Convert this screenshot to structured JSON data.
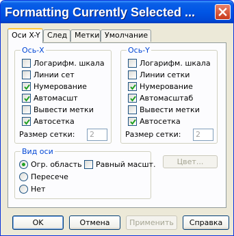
{
  "window": {
    "title": "Formatting Currently Selected ..."
  },
  "tabs": [
    "Оси X-Y",
    "След",
    "Метки",
    "Умолчание"
  ],
  "axis_x": {
    "legend": "Ось-X",
    "options": [
      {
        "label": "Логарифм. шкала",
        "checked": false
      },
      {
        "label": "Линии сет",
        "checked": false
      },
      {
        "label": "Нумерование",
        "checked": true
      },
      {
        "label": "Автомасшт",
        "checked": true
      },
      {
        "label": "Вывести метки",
        "checked": false
      },
      {
        "label": "Автосетка",
        "checked": true
      }
    ],
    "grid_size_label": "Размер сетки:",
    "grid_size_value": "2"
  },
  "axis_y": {
    "legend": "Ось-Y",
    "options": [
      {
        "label": "Логарифм. шкала",
        "checked": false
      },
      {
        "label": "Линии сетки",
        "checked": false
      },
      {
        "label": "Нумерование",
        "checked": true
      },
      {
        "label": "Автомасштаб",
        "checked": true
      },
      {
        "label": "Вывести метки",
        "checked": false
      },
      {
        "label": "Автосетка",
        "checked": true
      }
    ],
    "grid_size_label": "Размер сетки:",
    "grid_size_value": "2"
  },
  "axis_view": {
    "legend": "Вид оси",
    "radios": [
      {
        "label": "Огр. область",
        "selected": true
      },
      {
        "label": "Пересече",
        "selected": false
      },
      {
        "label": "Нет",
        "selected": false
      }
    ],
    "equal_scale_label": "Равный масшт.",
    "equal_scale_checked": false
  },
  "color_button": "Цвет...",
  "footer": {
    "ok": "OK",
    "cancel": "Отмена",
    "apply": "Применить",
    "help": "Справка"
  },
  "colors": {
    "title_bar": "#0055e5",
    "group_title": "#0046d5",
    "close_button": "#c8391a"
  }
}
